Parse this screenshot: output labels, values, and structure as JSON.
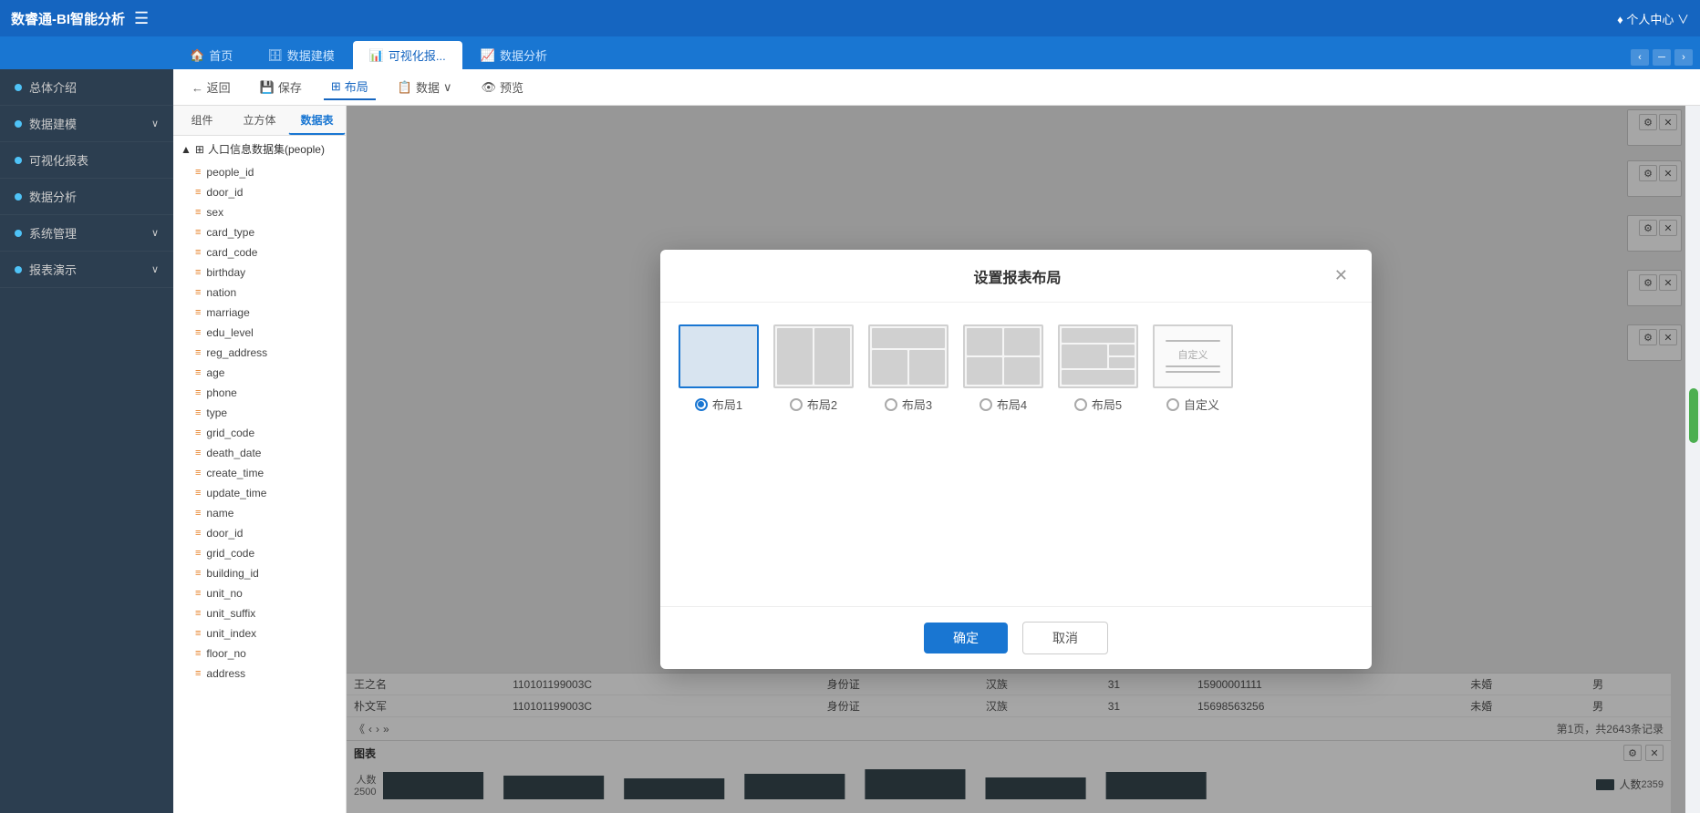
{
  "app": {
    "title": "数睿通-BI智能分析",
    "user_menu": "♦ 个人中心 ∨"
  },
  "tabs": [
    {
      "id": "home",
      "label": "首页",
      "icon": "🏠",
      "active": false
    },
    {
      "id": "data_model",
      "label": "数据建模",
      "icon": "🗄",
      "active": false
    },
    {
      "id": "visual",
      "label": "可视化报...",
      "icon": "📊",
      "active": true
    },
    {
      "id": "data_analysis",
      "label": "数据分析",
      "icon": "📈",
      "active": false
    }
  ],
  "toolbar": {
    "back_label": "← 返回",
    "save_label": "保存",
    "layout_label": "布局",
    "data_label": "数据",
    "preview_label": "预览"
  },
  "sub_toolbar": {
    "group_label": "组件",
    "cube_label": "立方体",
    "datatable_label": "数据表"
  },
  "sidebar": {
    "items": [
      {
        "id": "overview",
        "label": "总体介绍",
        "dot": true,
        "arrow": false
      },
      {
        "id": "data_model",
        "label": "数据建模",
        "dot": true,
        "arrow": true
      },
      {
        "id": "visual",
        "label": "可视化报表",
        "dot": true,
        "arrow": false
      },
      {
        "id": "data_analysis",
        "label": "数据分析",
        "dot": true,
        "arrow": false
      },
      {
        "id": "sys_mgmt",
        "label": "系统管理",
        "dot": true,
        "arrow": true
      },
      {
        "id": "report_demo",
        "label": "报表演示",
        "dot": true,
        "arrow": true
      }
    ]
  },
  "tree": {
    "root_label": "人口信息数据集(people)",
    "fields": [
      "people_id",
      "door_id",
      "sex",
      "card_type",
      "card_code",
      "birthday",
      "nation",
      "marriage",
      "edu_level",
      "reg_address",
      "age",
      "phone",
      "type",
      "grid_code",
      "death_date",
      "create_time",
      "update_time",
      "name",
      "door_id",
      "grid_code",
      "building_id",
      "unit_no",
      "unit_suffix",
      "unit_index",
      "floor_no",
      "address"
    ]
  },
  "modal": {
    "title": "设置报表布局",
    "layouts": [
      {
        "id": 1,
        "label": "布局1",
        "selected": true
      },
      {
        "id": 2,
        "label": "布局2",
        "selected": false
      },
      {
        "id": 3,
        "label": "布局3",
        "selected": false
      },
      {
        "id": 4,
        "label": "布局4",
        "selected": false
      },
      {
        "id": 5,
        "label": "布局5",
        "selected": false
      },
      {
        "id": 6,
        "label": "自定义",
        "selected": false
      }
    ],
    "confirm_label": "确定",
    "cancel_label": "取消"
  },
  "table": {
    "rows": [
      [
        "王之名",
        "110101199003C",
        "身份证",
        "汉族",
        "31",
        "15900001111",
        "未婚",
        "男"
      ],
      [
        "朴文军",
        "110101199003C",
        "身份证",
        "汉族",
        "31",
        "15698563256",
        "未婚",
        "男"
      ]
    ],
    "pagination": "第1页，共2643条记录"
  },
  "chart": {
    "title": "图表",
    "y_label": "人数",
    "y_value": "2500",
    "x_value": "2359",
    "legend_label": "人数"
  },
  "colors": {
    "primary": "#1565c0",
    "accent": "#1976d2",
    "sidebar_bg": "#2c3e50"
  }
}
